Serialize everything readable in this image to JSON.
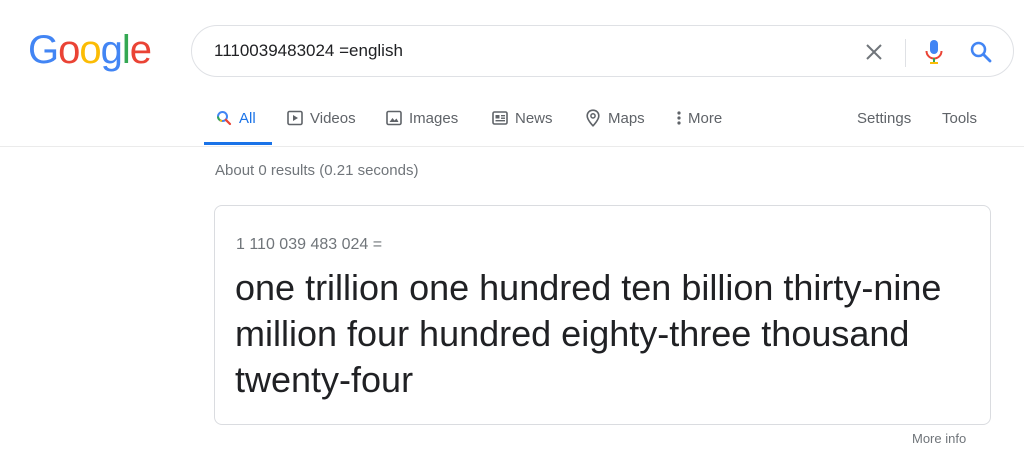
{
  "logo": {
    "text": "Google",
    "letters": [
      {
        "ch": "G",
        "color": "#4285F4"
      },
      {
        "ch": "o",
        "color": "#EA4335"
      },
      {
        "ch": "o",
        "color": "#FBBC05"
      },
      {
        "ch": "g",
        "color": "#4285F4"
      },
      {
        "ch": "l",
        "color": "#34A853"
      },
      {
        "ch": "e",
        "color": "#EA4335"
      }
    ]
  },
  "search": {
    "query": "1110039483024 =english"
  },
  "tabs": [
    {
      "label": "All",
      "icon": "search-icon",
      "active": true
    },
    {
      "label": "Videos",
      "icon": "play-icon"
    },
    {
      "label": "Images",
      "icon": "image-icon"
    },
    {
      "label": "News",
      "icon": "news-icon"
    },
    {
      "label": "Maps",
      "icon": "map-pin-icon"
    },
    {
      "label": "More",
      "icon": "more-vert-icon"
    }
  ],
  "tools": {
    "settings": "Settings",
    "tools": "Tools"
  },
  "stats": "About 0 results (0.21 seconds)",
  "card": {
    "expression": "1 110 039 483 024 =",
    "answer": "one trillion one hundred ten billion thirty-nine million four hundred eighty-three thousand twenty-four"
  },
  "footer": {
    "more_info": "More info"
  },
  "colors": {
    "accent": "#1a73e8",
    "muted": "#70757a",
    "text": "#202124"
  }
}
